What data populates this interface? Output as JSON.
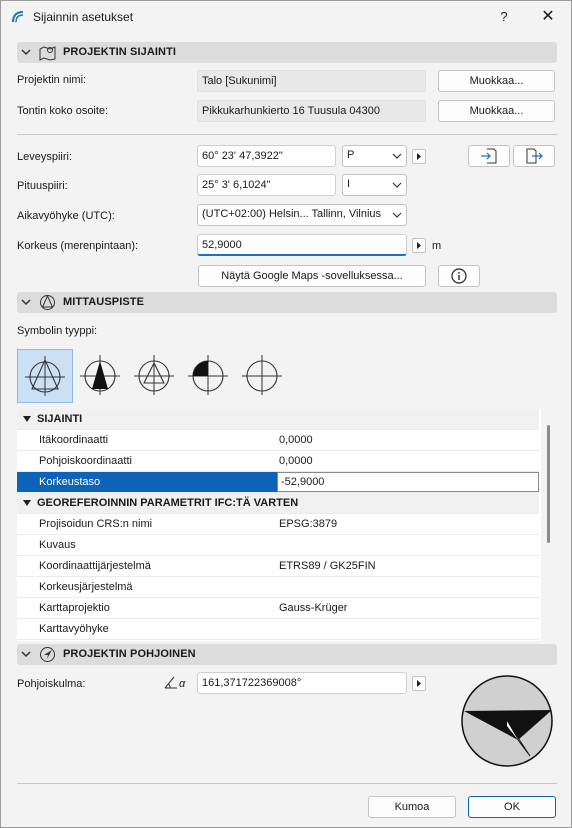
{
  "window": {
    "title": "Sijainnin asetukset",
    "help_label": "?",
    "close_label": "✕"
  },
  "sections": {
    "location": "PROJEKTIN SIJAINTI",
    "survey_point": "MITTAUSPISTE",
    "north": "PROJEKTIN POHJOINEN"
  },
  "location": {
    "project_name_label": "Projektin nimi:",
    "project_name_value": "Talo [Sukunimi]",
    "site_address_label": "Tontin koko osoite:",
    "site_address_value": "Pikkukarhunkierto 16 Tuusula 04300",
    "edit_label": "Muokkaa...",
    "latitude_label": "Leveyspiiri:",
    "latitude_value": "60° 23' 47,3922\"",
    "latitude_dir": "P",
    "longitude_label": "Pituuspiiri:",
    "longitude_value": "25° 3' 6,1024\"",
    "longitude_dir": "I",
    "timezone_label": "Aikavyöhyke (UTC):",
    "timezone_value": "(UTC+02:00) Helsin... Tallinn, Vilnius",
    "altitude_label": "Korkeus (merenpintaan):",
    "altitude_value": "52,9000",
    "altitude_unit": "m",
    "maps_button": "Näytä Google Maps -sovelluksessa...",
    "info_icon": "info-icon"
  },
  "survey": {
    "symbol_type_label": "Symbolin tyyppi:",
    "symbols": [
      "survey-symbol-1",
      "survey-symbol-2",
      "survey-symbol-3",
      "survey-symbol-4",
      "survey-symbol-5"
    ],
    "selected_symbol": 0
  },
  "grid": {
    "group1": "SIJAINTI",
    "rows1": [
      {
        "key": "Itäkoordinaatti",
        "value": "0,0000"
      },
      {
        "key": "Pohjoiskoordinaatti",
        "value": "0,0000"
      },
      {
        "key": "Korkeustaso",
        "value": "-52,9000"
      }
    ],
    "group2": "GEOREFEROINNIN PARAMETRIT IFC:TÄ VARTEN",
    "rows2": [
      {
        "key": "Projisoidun CRS:n nimi",
        "value": "EPSG:3879"
      },
      {
        "key": "Kuvaus",
        "value": ""
      },
      {
        "key": "Koordinaattijärjestelmä",
        "value": "ETRS89 / GK25FIN"
      },
      {
        "key": "Korkeusjärjestelmä",
        "value": ""
      },
      {
        "key": "Karttaprojektio",
        "value": "Gauss-Krüger"
      },
      {
        "key": "Karttavyöhyke",
        "value": ""
      }
    ]
  },
  "north": {
    "angle_label": "Pohjoiskulma:",
    "angle_value": "161,371722369008°",
    "angle_prefix": "α"
  },
  "footer": {
    "cancel": "Kumoa",
    "ok": "OK"
  },
  "colors": {
    "accent": "#0c63b8",
    "section_bg": "#dcdcdc",
    "dialog_bg": "#f3f3f3"
  }
}
